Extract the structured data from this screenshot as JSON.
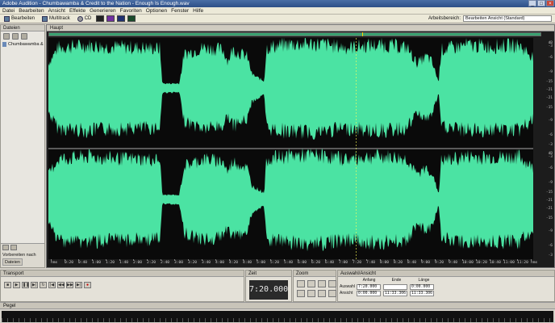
{
  "window": {
    "title": "Adobe Audition - Chumbawamba & Credit to the Nation - Enough Is Enough.wav"
  },
  "menu": [
    "Datei",
    "Bearbeiten",
    "Ansicht",
    "Effekte",
    "Generieren",
    "Favoriten",
    "Optionen",
    "Fenster",
    "Hilfe"
  ],
  "toolbar": {
    "edit_view_label": "Bearbeiten",
    "multitrack_label": "Multitrack",
    "cd_label": "CD",
    "workspace_label": "Arbeitsbereich:",
    "workspace_value": "Bearbeiten Ansicht (Standard)"
  },
  "files_panel": {
    "tab": "Dateien",
    "items": [
      "Chumbawamba &"
    ],
    "autoplay_label": "Vorbereiten nach",
    "bottom_tabs": [
      "Dateien"
    ]
  },
  "main_panel": {
    "tab": "Haupt",
    "waveform_color": "#4be3a3",
    "db_ticks": [
      "dB",
      "-3",
      "-6",
      "-9",
      "-15",
      "-21",
      "-21",
      "-15",
      "-9",
      "-6",
      "-3"
    ],
    "time_ticks": [
      "hms",
      "0:20",
      "0:40",
      "1:00",
      "1:20",
      "1:40",
      "2:00",
      "2:20",
      "2:40",
      "3:00",
      "3:20",
      "3:40",
      "4:00",
      "4:20",
      "4:40",
      "5:00",
      "5:20",
      "5:40",
      "6:00",
      "6:20",
      "6:40",
      "7:00",
      "7:20",
      "7:40",
      "8:00",
      "8:20",
      "8:40",
      "9:00",
      "9:20",
      "9:40",
      "10:00",
      "10:20",
      "10:40",
      "11:00",
      "11:20",
      "hms"
    ]
  },
  "transport": {
    "tab": "Transport"
  },
  "time": {
    "tab": "Zeit",
    "display": "7:20.000"
  },
  "zoom": {
    "tab": "Zoom"
  },
  "selection": {
    "tab": "Auswahl/Ansicht",
    "col_start": "Anfang",
    "col_end": "Ende",
    "col_length": "Länge",
    "row_selection": "Auswahl",
    "row_view": "Ansicht",
    "sel_start": "7:20.000",
    "sel_end": "",
    "sel_length": "0:00.000",
    "view_start": "0:00.000",
    "view_end": "11:33.306",
    "view_length": "11:33.306"
  },
  "levels": {
    "tab": "Pegel"
  }
}
